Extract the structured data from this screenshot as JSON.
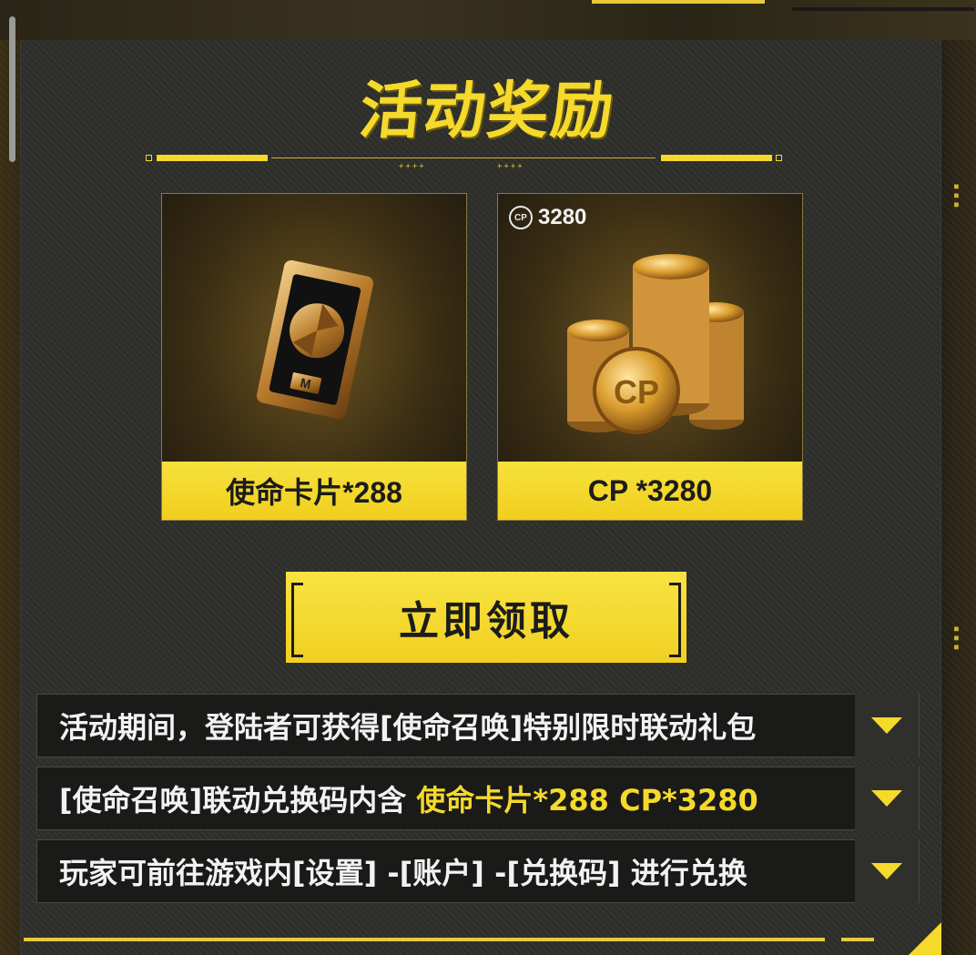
{
  "title": "活动奖励",
  "colors": {
    "accent": "#f5d92b",
    "panel": "#2d2d2a",
    "row_bg": "#1a1a18"
  },
  "rewards": [
    {
      "label": "使命卡片*288",
      "icon": "mission-card-icon"
    },
    {
      "label": "CP *3280",
      "icon": "cp-coins-icon",
      "badge_icon": "cp-icon",
      "badge_amount": "3280"
    }
  ],
  "claim_button": "立即领取",
  "info": [
    {
      "text": "活动期间，登陆者可获得[使命召唤]特别限时联动礼包",
      "highlight": ""
    },
    {
      "text": "[使命召唤]联动兑换码内含 ",
      "highlight": "使命卡片*288 CP*3280"
    },
    {
      "text": "玩家可前往游戏内[设置] -[账户] -[兑换码] 进行兑换",
      "highlight": ""
    }
  ],
  "toggle_icon": "triangle-down-icon",
  "divider_dots": "++++"
}
